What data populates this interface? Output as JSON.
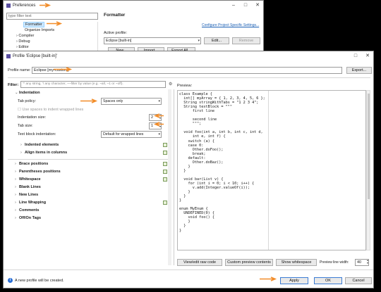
{
  "prefs": {
    "title": "Preferences",
    "filter_placeholder": "type filter text",
    "tree": [
      "Formatter",
      "Organize Imports",
      "Compiler",
      "Debug",
      "Editor"
    ],
    "header": "Formatter",
    "configure_link": "Configure Project Specific Settings...",
    "active_profile_label": "Active profile:",
    "active_profile_value": "Eclipse [built-in]",
    "edit_label": "Edit...",
    "remove_label": "Remove",
    "new_label": "New...",
    "import_label": "Import...",
    "export_all_label": "Export All..."
  },
  "dialog": {
    "title": "Profile 'Eclipse [built-in]'",
    "profile_name_label": "Profile name:",
    "profile_name_value": "Eclipse [my-custom]",
    "export_label": "Export...",
    "filter_label": "Filter:",
    "filter_placeholder": "'^ any string, '\\ any character, ~~filter by value (e.g. ~all, ~1 or ~off).",
    "preview_label": "Preview:",
    "indentation_section": "Indentation",
    "tab_policy_label": "Tab policy:",
    "tab_policy_value": "Spaces only",
    "use_spaces_label": "Use spaces to indent wrapped lines",
    "indentation_size_label": "Indentation size:",
    "indentation_size_value": "2",
    "tab_size_label": "Tab size:",
    "tab_size_value": "1",
    "text_block_label": "Text block indentation:",
    "text_block_value": "Default for wrapped lines",
    "indented_elements": "Indented elements",
    "align_items": "Align items in columns",
    "sections": [
      "Brace positions",
      "Parentheses positions",
      "Whitespace",
      "Blank Lines",
      "New Lines",
      "Line Wrapping",
      "Comments",
      "Off/On Tags"
    ],
    "code_lines": [
      "class Example {",
      "  int[] myArray = { 1, 2, 3, 4, 5, 6 };",
      "  String stringWithTabs = \"1 2 3 4\";",
      "  String textBlock = \"\"\"",
      "      first line",
      "",
      "      second line",
      "      \"\"\";",
      "",
      "  void foo(int a, int b, int c, int d,",
      "      int e, int f) {",
      "    switch (a) {",
      "    case 0:",
      "      Other.doFoo();",
      "      break;",
      "    default:",
      "      Other.doBaz();",
      "    }",
      "  }",
      "",
      "  void bar(List v) {",
      "    for (int i = 0; i < 10; i++) {",
      "      v.add(Integer.valueOf(i));",
      "    }",
      "  }",
      "}",
      "",
      "enum MyEnum {",
      "  UNDEFINED(0) {",
      "    void foo() {",
      "    }",
      "  }",
      "}"
    ],
    "view_raw_label": "View/edit raw code",
    "custom_preview_label": "Custom preview contents",
    "show_whitespace_label": "Show whitespace",
    "line_width_label": "Preview line width:",
    "line_width_value": "40",
    "status": "A new profile will be created.",
    "apply_label": "Apply",
    "ok_label": "OK",
    "cancel_label": "Cancel"
  },
  "colors": {
    "accent": "#f28c28",
    "link": "#1a5fb4"
  }
}
